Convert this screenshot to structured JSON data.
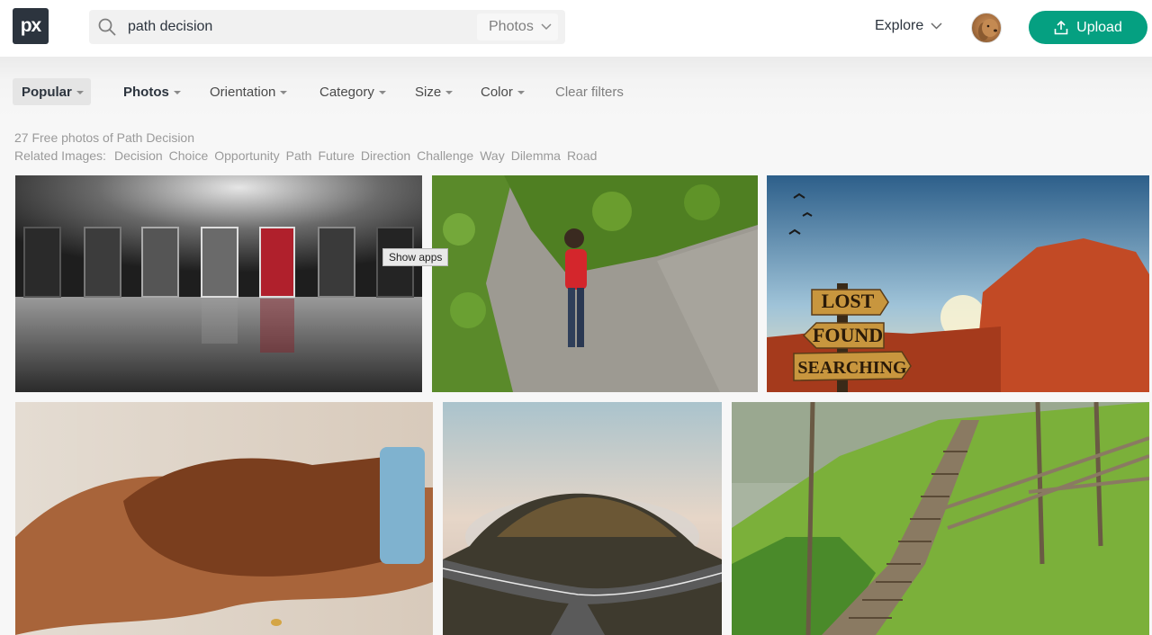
{
  "header": {
    "logo": "px",
    "search_query": "path decision",
    "search_type": "Photos",
    "explore_label": "Explore",
    "upload_label": "Upload",
    "brand_color": "#05a081"
  },
  "filters": [
    {
      "label": "Popular"
    },
    {
      "label": "Photos"
    },
    {
      "label": "Orientation"
    },
    {
      "label": "Category"
    },
    {
      "label": "Size"
    },
    {
      "label": "Color"
    },
    {
      "label": "Clear filters"
    }
  ],
  "results": {
    "count_text": "27 Free photos of Path Decision",
    "related_label": "Related Images:",
    "related_tags": [
      "Decision",
      "Choice",
      "Opportunity",
      "Path",
      "Future",
      "Direction",
      "Challenge",
      "Way",
      "Dilemma",
      "Road"
    ]
  },
  "tooltip": "Show apps",
  "photos": [
    {
      "subject": "doors"
    },
    {
      "subject": "child-on-path"
    },
    {
      "subject": "signpost",
      "signs": [
        "LOST",
        "FOUND",
        "SEARCHING"
      ]
    },
    {
      "subject": "handshake"
    },
    {
      "subject": "road-fork"
    },
    {
      "subject": "stairs"
    }
  ]
}
